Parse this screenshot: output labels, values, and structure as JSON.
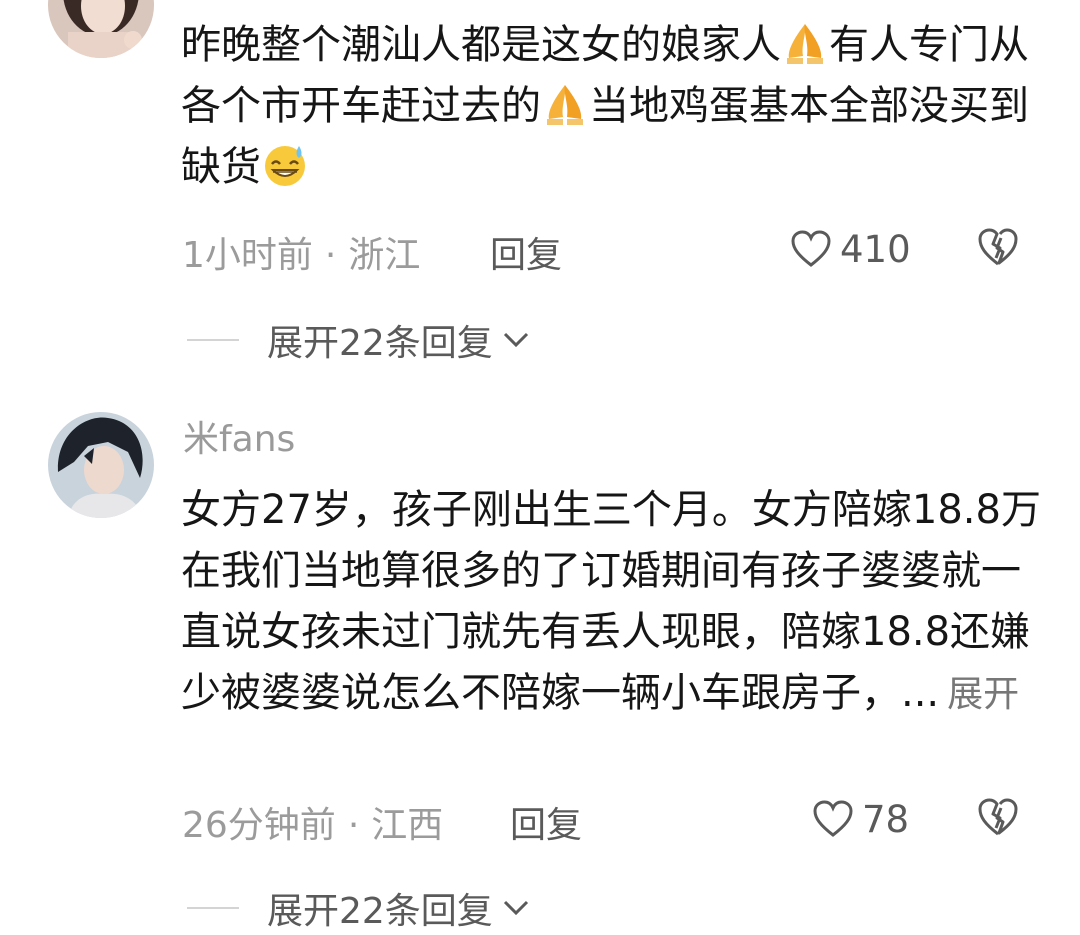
{
  "comments": [
    {
      "username": "",
      "text_parts": [
        "昨晚整个潮汕人都是这女的娘家人",
        "有人专门从各个市开车赶过去的",
        "当地鸡蛋基本全部没买到缺货"
      ],
      "time": "1小时前",
      "location": "浙江",
      "reply_label": "回复",
      "likes": "410",
      "expand_replies": "展开22条回复",
      "icons": [
        "pray-emoji-icon",
        "pray-emoji-icon",
        "grin-sweat-emoji-icon"
      ]
    },
    {
      "username": "米fans",
      "text": "女方27岁，孩子刚出生三个月。女方陪嫁18.8万在我们当地算很多的了订婚期间有孩子婆婆就一直说女孩未过门就先有丢人现眼，陪嫁18.8还嫌少被婆婆说怎么不陪嫁一辆小车跟房子，...",
      "more_label": "展开",
      "time": "26分钟前",
      "location": "江西",
      "reply_label": "回复",
      "likes": "78",
      "expand_replies": "展开22条回复"
    }
  ],
  "ui": {
    "separator_dot": "·",
    "like_icon": "heart-outline-icon",
    "dislike_icon": "broken-heart-icon",
    "chevron_icon": "chevron-down-icon"
  }
}
